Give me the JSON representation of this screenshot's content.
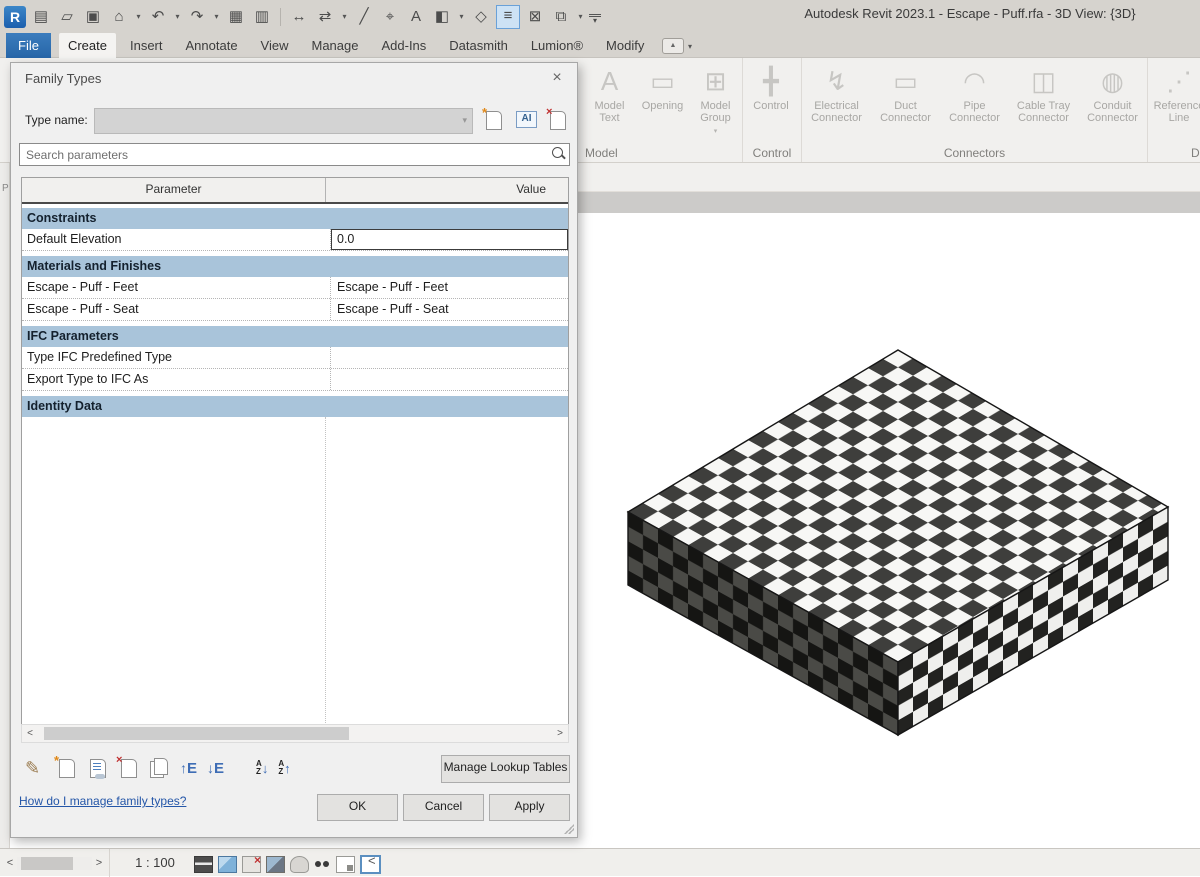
{
  "glyphs": {
    "caret": "▾",
    "chevron_left": "<",
    "chevron_right": ">",
    "close": "×",
    "star": "*",
    "red_x": "×",
    "up": "↑",
    "down": "↓",
    "panel_up": "▲"
  },
  "colors": {
    "file_tab_blue": "#2766a8",
    "section_header_blue": "#a9c4da",
    "link_blue": "#2456a8",
    "qat_active_bg": "#cde2f5"
  },
  "window": {
    "title": "Autodesk Revit 2023.1 - Escape - Puff.rfa - 3D View: {3D}"
  },
  "qat": {
    "items": [
      {
        "name": "revit-logo",
        "glyph": "R"
      },
      {
        "name": "properties-icon",
        "glyph": "▤"
      },
      {
        "name": "open-icon",
        "glyph": "▱"
      },
      {
        "name": "save-icon",
        "glyph": "▣"
      },
      {
        "name": "home-view-icon",
        "glyph": "⌂"
      },
      {
        "name": "undo-icon",
        "glyph": "↶"
      },
      {
        "name": "redo-icon",
        "glyph": "↷"
      },
      {
        "name": "print-icon",
        "glyph": "▦"
      },
      {
        "name": "export-pdf-icon",
        "glyph": "▥"
      },
      {
        "name": "measure-icon",
        "glyph": "↔"
      },
      {
        "name": "aligned-dimension-icon",
        "glyph": "⇄"
      },
      {
        "name": "detail-measure-icon",
        "glyph": "╱"
      },
      {
        "name": "tag-by-category-icon",
        "glyph": "⌖"
      },
      {
        "name": "text-icon",
        "glyph": "A"
      },
      {
        "name": "default-3d-view-icon",
        "glyph": "◧"
      },
      {
        "name": "section-icon",
        "glyph": "◇"
      },
      {
        "name": "family-types-icon",
        "glyph": "≡"
      },
      {
        "name": "close-hidden-windows-icon",
        "glyph": "⊠"
      },
      {
        "name": "switch-windows-icon",
        "glyph": "⧉"
      },
      {
        "name": "customize-qat-icon",
        "glyph": "▾"
      }
    ]
  },
  "tabs": [
    {
      "label": "File"
    },
    {
      "label": "Create"
    },
    {
      "label": "Insert"
    },
    {
      "label": "Annotate"
    },
    {
      "label": "View"
    },
    {
      "label": "Manage"
    },
    {
      "label": "Add-Ins"
    },
    {
      "label": "Datasmith"
    },
    {
      "label": "Lumion®"
    },
    {
      "label": "Modify"
    }
  ],
  "ribbon": {
    "panels": [
      {
        "label": "Model",
        "buttons": [
          {
            "label": "Model Text",
            "glyph": "A"
          },
          {
            "label": "Opening",
            "glyph": "▭"
          },
          {
            "label": "Model Group",
            "glyph": "⊞"
          }
        ]
      },
      {
        "label": "Control",
        "buttons": [
          {
            "label": "Control",
            "glyph": "╋"
          }
        ]
      },
      {
        "label": "Connectors",
        "buttons": [
          {
            "label": "Electrical Connector",
            "glyph": "↯"
          },
          {
            "label": "Duct Connector",
            "glyph": "▭"
          },
          {
            "label": "Pipe Connector",
            "glyph": "◠"
          },
          {
            "label": "Cable Tray Connector",
            "glyph": "◫"
          },
          {
            "label": "Conduit Connector",
            "glyph": "◍"
          }
        ]
      },
      {
        "label": "Da",
        "buttons": [
          {
            "label": "Reference Line",
            "glyph": "⋰"
          }
        ]
      }
    ]
  },
  "left_panel": {
    "visible_label": "P"
  },
  "dialog": {
    "title": "Family Types",
    "type_name_label": "Type name:",
    "type_name_value": "",
    "rename_icon_label": "AI",
    "search": {
      "placeholder": "Search parameters"
    },
    "table": {
      "columns": [
        "Parameter",
        "Value"
      ],
      "groups": [
        {
          "header": "Constraints",
          "rows": [
            {
              "param": "Default Elevation",
              "value": "0.0"
            }
          ]
        },
        {
          "header": "Materials and Finishes",
          "rows": [
            {
              "param": "Escape - Puff - Feet",
              "value": "Escape - Puff - Feet"
            },
            {
              "param": "Escape - Puff - Seat",
              "value": "Escape - Puff - Seat"
            }
          ]
        },
        {
          "header": "IFC Parameters",
          "rows": [
            {
              "param": "Type IFC Predefined Type",
              "value": ""
            },
            {
              "param": "Export Type to IFC As",
              "value": ""
            }
          ]
        },
        {
          "header": "Identity Data",
          "rows": []
        }
      ]
    },
    "toolbar": {
      "e_label": "E",
      "a_label": "A",
      "z_label": "Z"
    },
    "manage_lookup_label": "Manage Lookup Tables",
    "help_link": "How do I manage family types?",
    "ok_label": "OK",
    "cancel_label": "Cancel",
    "apply_label": "Apply"
  },
  "status_bar": {
    "scale": "1 : 100",
    "icons": [
      "detail-level-icon",
      "visual-style-icon",
      "sun-path-icon",
      "shadows-icon",
      "rendering-dialog-icon",
      "hide-isolate-icon",
      "locked-orientation-icon",
      "reveal-hidden-icon"
    ]
  },
  "viewport": {
    "object": {
      "name": "puff-3d-model",
      "top_light": "#f7f7f5",
      "top_dark": "#3e3e3c",
      "left_light": "#4a4a46",
      "left_dark": "#151513",
      "right_light": "#efefed",
      "right_dark": "#222220",
      "outline": "#161616"
    }
  }
}
